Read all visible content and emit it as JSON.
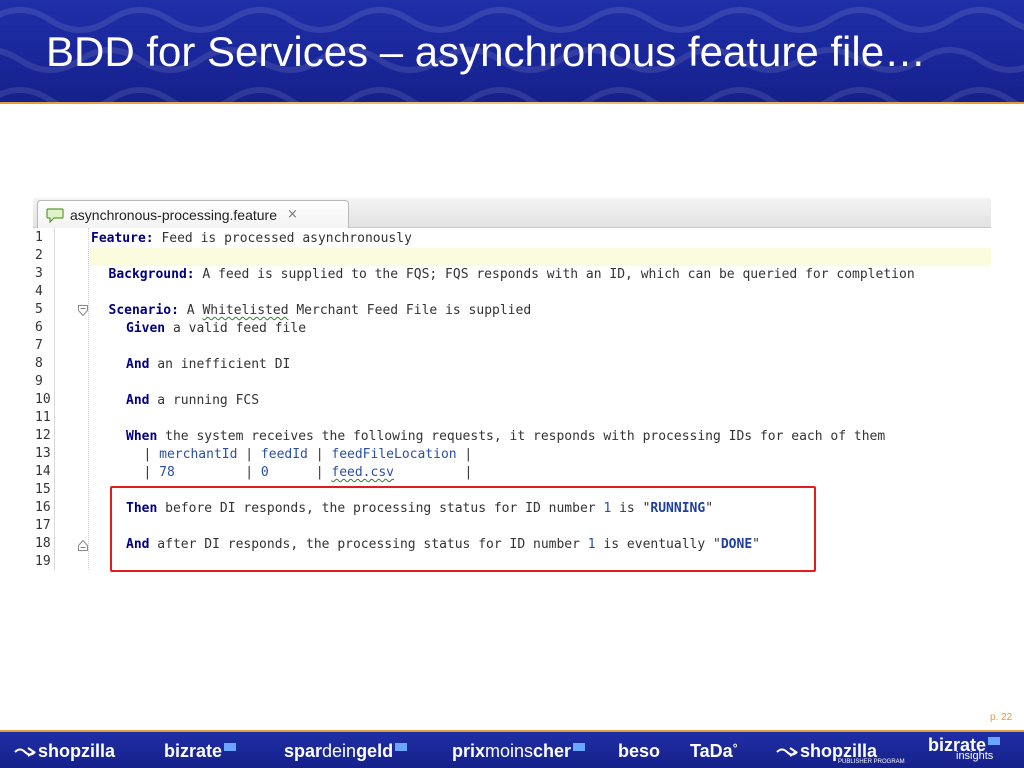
{
  "slide": {
    "title": "BDD for Services – asynchronous feature file…",
    "page_number": "p. 22"
  },
  "editor": {
    "tab_label": "asynchronous-processing.feature",
    "tab_close": "×",
    "lines": [
      {
        "n": "1",
        "indent": 0,
        "parts": [
          {
            "t": "Feature:",
            "c": "kw"
          },
          {
            "t": " Feed is processed asynchronously",
            "c": "txt"
          }
        ]
      },
      {
        "n": "2",
        "indent": 0,
        "parts": [],
        "highlight": true
      },
      {
        "n": "3",
        "indent": 1,
        "parts": [
          {
            "t": "Background:",
            "c": "kw"
          },
          {
            "t": " A feed is supplied to the FQS; FQS responds with an ID, which can be queried for completion",
            "c": "txt"
          }
        ]
      },
      {
        "n": "4",
        "indent": 0,
        "parts": []
      },
      {
        "n": "5",
        "indent": 1,
        "parts": [
          {
            "t": "Scenario:",
            "c": "kw"
          },
          {
            "t": " A ",
            "c": "txt"
          },
          {
            "t": "Whitelisted",
            "c": "txt squiggle"
          },
          {
            "t": " Merchant Feed File is supplied",
            "c": "txt"
          }
        ],
        "fold": "open"
      },
      {
        "n": "6",
        "indent": 2,
        "parts": [
          {
            "t": "Given",
            "c": "kw"
          },
          {
            "t": " a valid feed file",
            "c": "txt"
          }
        ]
      },
      {
        "n": "7",
        "indent": 0,
        "parts": []
      },
      {
        "n": "8",
        "indent": 2,
        "parts": [
          {
            "t": "And",
            "c": "kw"
          },
          {
            "t": " an inefficient DI",
            "c": "txt"
          }
        ]
      },
      {
        "n": "9",
        "indent": 0,
        "parts": []
      },
      {
        "n": "10",
        "indent": 2,
        "parts": [
          {
            "t": "And",
            "c": "kw"
          },
          {
            "t": " a running FCS",
            "c": "txt"
          }
        ]
      },
      {
        "n": "11",
        "indent": 0,
        "parts": []
      },
      {
        "n": "12",
        "indent": 2,
        "parts": [
          {
            "t": "When",
            "c": "kw"
          },
          {
            "t": " the system receives the following requests, it responds with processing IDs for each of them",
            "c": "txt"
          }
        ]
      },
      {
        "n": "13",
        "indent": 3,
        "parts": [
          {
            "t": "| ",
            "c": "pipe"
          },
          {
            "t": "merchantId",
            "c": "hdr"
          },
          {
            "t": " | ",
            "c": "pipe"
          },
          {
            "t": "feedId",
            "c": "hdr"
          },
          {
            "t": " | ",
            "c": "pipe"
          },
          {
            "t": "feedFileLocation",
            "c": "hdr"
          },
          {
            "t": " |",
            "c": "pipe"
          }
        ]
      },
      {
        "n": "14",
        "indent": 3,
        "parts": [
          {
            "t": "| ",
            "c": "pipe"
          },
          {
            "t": "78        ",
            "c": "num"
          },
          {
            "t": " | ",
            "c": "pipe"
          },
          {
            "t": "0     ",
            "c": "num"
          },
          {
            "t": " | ",
            "c": "pipe"
          },
          {
            "t": "feed.csv",
            "c": "num squiggle"
          },
          {
            "t": "         |",
            "c": "pipe"
          }
        ]
      },
      {
        "n": "15",
        "indent": 0,
        "parts": []
      },
      {
        "n": "16",
        "indent": 2,
        "parts": [
          {
            "t": "Then",
            "c": "kw"
          },
          {
            "t": " before DI responds, the processing status for ID number ",
            "c": "txt"
          },
          {
            "t": "1",
            "c": "num"
          },
          {
            "t": " is \"",
            "c": "txt"
          },
          {
            "t": "RUNNING",
            "c": "str"
          },
          {
            "t": "\"",
            "c": "txt"
          }
        ]
      },
      {
        "n": "17",
        "indent": 0,
        "parts": []
      },
      {
        "n": "18",
        "indent": 2,
        "parts": [
          {
            "t": "And",
            "c": "kw"
          },
          {
            "t": " after DI responds, the processing status for ID number ",
            "c": "txt"
          },
          {
            "t": "1",
            "c": "num"
          },
          {
            "t": " is eventually \"",
            "c": "txt"
          },
          {
            "t": "DONE",
            "c": "str"
          },
          {
            "t": "\"",
            "c": "txt"
          }
        ],
        "fold": "close"
      },
      {
        "n": "19",
        "indent": 0,
        "parts": []
      }
    ]
  },
  "footer": {
    "brands": [
      {
        "name": "shopzilla",
        "bold": "shopzilla",
        "light": ""
      },
      {
        "name": "bizrate",
        "bold": "bizrate",
        "light": ""
      },
      {
        "name": "spardeingeld",
        "bold": "spar",
        "light": "dein",
        "bold2": "geld"
      },
      {
        "name": "prixmoinscher",
        "bold": "prix",
        "light": "moins",
        "bold2": "cher"
      },
      {
        "name": "beso",
        "bold": "beso",
        "light": ""
      },
      {
        "name": "tada",
        "bold": "TaDa",
        "light": ""
      },
      {
        "name": "shopzilla-publisher",
        "bold": "shopzilla",
        "light": "",
        "sub": "PUBLISHER PROGRAM"
      },
      {
        "name": "bizrate-insights",
        "bold": "bizrate",
        "light": "",
        "sub": "insights"
      }
    ]
  },
  "colors": {
    "header_blue": "#1a279a",
    "accent_orange": "#e39a3c",
    "keyword_navy": "#000080",
    "callout_red": "#e21b1b"
  }
}
